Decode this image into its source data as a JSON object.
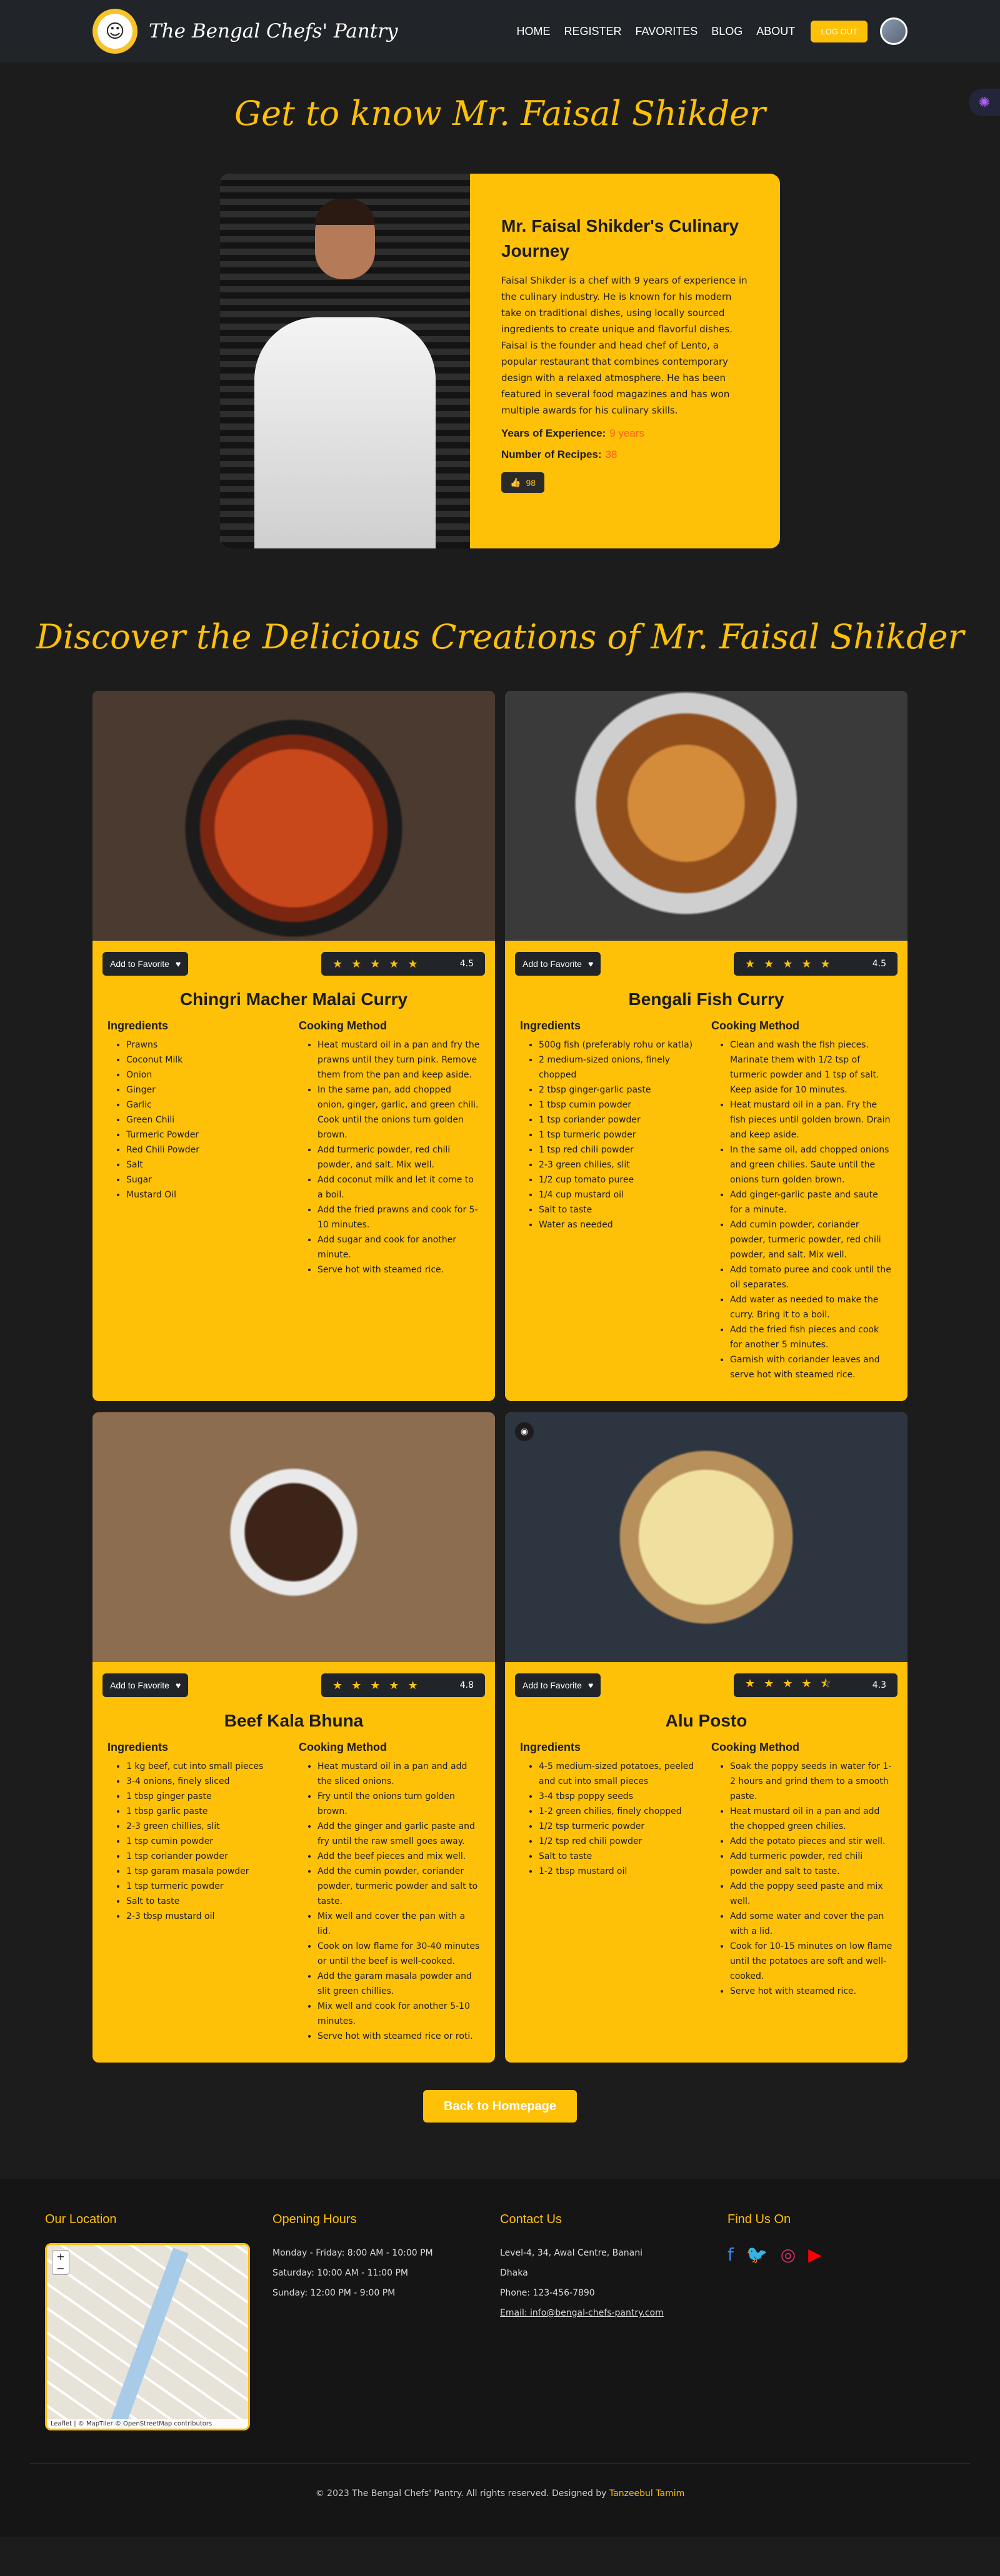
{
  "nav": {
    "brand": "The Bengal Chefs' Pantry",
    "links": [
      "HOME",
      "REGISTER",
      "FAVORITES",
      "BLOG",
      "ABOUT"
    ],
    "logout_label": "LOG OUT"
  },
  "about": {
    "title": "Get to know Mr. Faisal Shikder",
    "heading": "Mr. Faisal Shikder's Culinary Journey",
    "bio": "Faisal Shikder is a chef with 9 years of experience in the culinary industry. He is known for his modern take on traditional dishes, using locally sourced ingredients to create unique and flavorful dishes. Faisal is the founder and head chef of Lento, a popular restaurant that combines contemporary design with a relaxed atmosphere. He has been featured in several food magazines and has won multiple awards for his culinary skills.",
    "experience_label": "Years of Experience:",
    "experience_value": "9 years",
    "recipes_label": "Number of Recipes:",
    "recipes_value": "38",
    "likes": "98"
  },
  "recipes_title": "Discover the Delicious Creations of Mr. Faisal Shikder",
  "ui": {
    "fav_label": "Add to Favorite",
    "ingredients_label": "Ingredients",
    "method_label": "Cooking Method"
  },
  "recipes": [
    {
      "name": "Chingri Macher Malai Curry",
      "rating": "4.5",
      "stars": "★★★★★",
      "ingredients": [
        "Prawns",
        "Coconut Milk",
        "Onion",
        "Ginger",
        "Garlic",
        "Green Chili",
        "Turmeric Powder",
        "Red Chili Powder",
        "Salt",
        "Sugar",
        "Mustard Oil"
      ],
      "method": [
        "Heat mustard oil in a pan and fry the prawns until they turn pink. Remove them from the pan and keep aside.",
        "In the same pan, add chopped onion, ginger, garlic, and green chili. Cook until the onions turn golden brown.",
        "Add turmeric powder, red chili powder, and salt. Mix well.",
        "Add coconut milk and let it come to a boil.",
        "Add the fried prawns and cook for 5-10 minutes.",
        "Add sugar and cook for another minute.",
        "Serve hot with steamed rice."
      ]
    },
    {
      "name": "Bengali Fish Curry",
      "rating": "4.5",
      "stars": "★★★★★",
      "ingredients": [
        "500g fish (preferably rohu or katla)",
        "2 medium-sized onions, finely chopped",
        "2 tbsp ginger-garlic paste",
        "1 tbsp cumin powder",
        "1 tsp coriander powder",
        "1 tsp turmeric powder",
        "1 tsp red chili powder",
        "2-3 green chilies, slit",
        "1/2 cup tomato puree",
        "1/4 cup mustard oil",
        "Salt to taste",
        "Water as needed"
      ],
      "method": [
        "Clean and wash the fish pieces. Marinate them with 1/2 tsp of turmeric powder and 1 tsp of salt. Keep aside for 10 minutes.",
        "Heat mustard oil in a pan. Fry the fish pieces until golden brown. Drain and keep aside.",
        "In the same oil, add chopped onions and green chilies. Saute until the onions turn golden brown.",
        "Add ginger-garlic paste and saute for a minute.",
        "Add cumin powder, coriander powder, turmeric powder, red chili powder, and salt. Mix well.",
        "Add tomato puree and cook until the oil separates.",
        "Add water as needed to make the curry. Bring it to a boil.",
        "Add the fried fish pieces and cook for another 5 minutes.",
        "Garnish with coriander leaves and serve hot with steamed rice."
      ]
    },
    {
      "name": "Beef Kala Bhuna",
      "rating": "4.8",
      "stars": "★★★★★",
      "ingredients": [
        "1 kg beef, cut into small pieces",
        "3-4 onions, finely sliced",
        "1 tbsp ginger paste",
        "1 tbsp garlic paste",
        "2-3 green chillies, slit",
        "1 tsp cumin powder",
        "1 tsp coriander powder",
        "1 tsp garam masala powder",
        "1 tsp turmeric powder",
        "Salt to taste",
        "2-3 tbsp mustard oil"
      ],
      "method": [
        "Heat mustard oil in a pan and add the sliced onions.",
        "Fry until the onions turn golden brown.",
        "Add the ginger and garlic paste and fry until the raw smell goes away.",
        "Add the beef pieces and mix well.",
        "Add the cumin powder, coriander powder, turmeric powder and salt to taste.",
        "Mix well and cover the pan with a lid.",
        "Cook on low flame for 30-40 minutes or until the beef is well-cooked.",
        "Add the garam masala powder and slit green chillies.",
        "Mix well and cook for another 5-10 minutes.",
        "Serve hot with steamed rice or roti."
      ]
    },
    {
      "name": "Alu Posto",
      "rating": "4.3",
      "stars": "★★★★⯪",
      "ingredients": [
        "4-5 medium-sized potatoes, peeled and cut into small pieces",
        "3-4 tbsp poppy seeds",
        "1-2 green chilies, finely chopped",
        "1/2 tsp turmeric powder",
        "1/2 tsp red chili powder",
        "Salt to taste",
        "1-2 tbsp mustard oil"
      ],
      "method": [
        "Soak the poppy seeds in water for 1-2 hours and grind them to a smooth paste.",
        "Heat mustard oil in a pan and add the chopped green chilies.",
        "Add the potato pieces and stir well.",
        "Add turmeric powder, red chili powder and salt to taste.",
        "Add the poppy seed paste and mix well.",
        "Add some water and cover the pan with a lid.",
        "Cook for 10-15 minutes on low flame until the potatoes are soft and well-cooked.",
        "Serve hot with steamed rice."
      ]
    }
  ],
  "back_label": "Back to Homepage",
  "footer": {
    "location_title": "Our Location",
    "map_attribution": "Leaflet | © MapTiler © OpenStreetMap contributors",
    "hours_title": "Opening Hours",
    "hours": [
      "Monday - Friday: 8:00 AM - 10:00 PM",
      "Saturday: 10:00 AM - 11:00 PM",
      "Sunday: 12:00 PM - 9:00 PM"
    ],
    "contact_title": "Contact Us",
    "contact": [
      "Level-4, 34, Awal Centre, Banani",
      "Dhaka",
      "Phone: 123-456-7890",
      "Email: info@bengal-chefs-pantry.com"
    ],
    "social_title": "Find Us On",
    "copyright": "© 2023 The Bengal Chefs' Pantry. All rights reserved. Designed by",
    "designer": "Tanzeebul Tamim"
  },
  "colors": {
    "accent": "#ffc107",
    "nav_bg": "#212529",
    "page_bg": "#1c1c1c",
    "footer_bg": "#151515"
  }
}
